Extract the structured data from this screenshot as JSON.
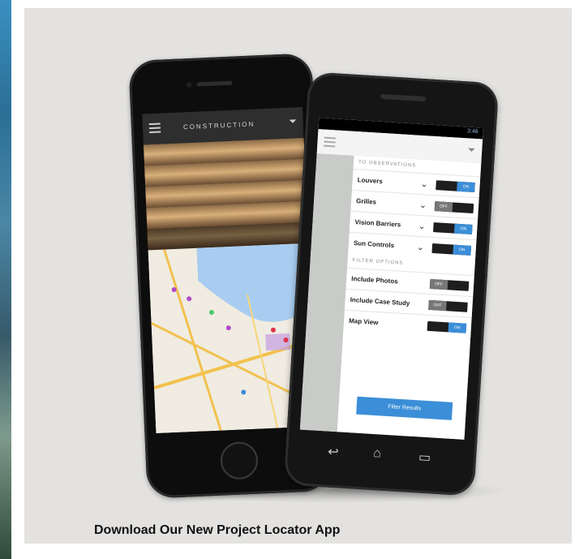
{
  "caption": "Download Our New Project Locator App",
  "iphone": {
    "brand": "CONSTRUCTION",
    "photo_caption": ""
  },
  "android": {
    "status_time": "3:46",
    "section_product": "TO OBSERVATIONS",
    "section_filter": "FILTER OPTIONS",
    "options": [
      {
        "label": "Louvers",
        "state": "ON"
      },
      {
        "label": "Grilles",
        "state": "OFF"
      },
      {
        "label": "Vision Barriers",
        "state": "ON"
      },
      {
        "label": "Sun Controls",
        "state": "ON"
      }
    ],
    "filters": [
      {
        "label": "Include Photos",
        "state": "OFF"
      },
      {
        "label": "Include Case Study",
        "state": "OFF"
      },
      {
        "label": "Map View",
        "state": "ON"
      }
    ],
    "find_button": "Filter Results"
  },
  "colors": {
    "accent": "#3b8ed8",
    "panel_bg": "#e3e2e0"
  }
}
